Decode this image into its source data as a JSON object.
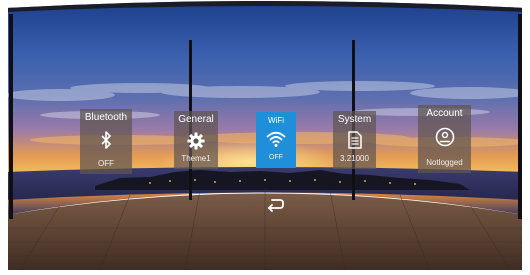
{
  "settings_menu": {
    "tiles": [
      {
        "title": "Bluetooth",
        "value": "OFF",
        "icon": "bluetooth-icon"
      },
      {
        "title": "General",
        "value": "Theme1",
        "icon": "gear-icon"
      },
      {
        "title": "WiFi",
        "value": "OFF",
        "icon": "wifi-icon"
      },
      {
        "title": "System",
        "value": "3.21000",
        "icon": "document-icon"
      },
      {
        "title": "Account",
        "value": "Notlogged",
        "icon": "account-icon"
      }
    ],
    "active_tile": "WiFi",
    "back_icon": "back-arrow-icon"
  },
  "colors": {
    "active_tile": "#1e8fd8",
    "tile_background": "#5f5550",
    "text": "#ffffff"
  }
}
